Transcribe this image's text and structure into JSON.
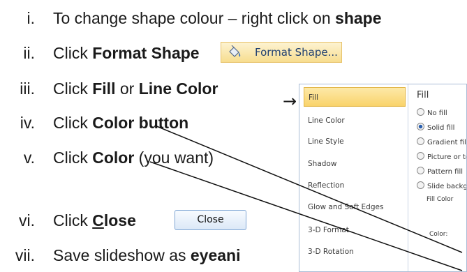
{
  "steps": [
    {
      "num": "i.",
      "pre": "To change shape colour – right click on ",
      "bold": "shape",
      "post": ""
    },
    {
      "num": "ii.",
      "pre": "Click ",
      "bold": "Format Shape",
      "post": ""
    },
    {
      "num": "iii.",
      "pre": "Click ",
      "bold": "Fill",
      "mid": " or ",
      "bold2": "Line Color",
      "post": ""
    },
    {
      "num": "iv.",
      "pre": "Click ",
      "bold": "Color button",
      "post": ""
    },
    {
      "num": "v.",
      "pre": "Click ",
      "bold": "Color",
      "post": " (you want)"
    },
    {
      "num": "vi.",
      "pre": "Click ",
      "bold_u": "C",
      "bold": "lose",
      "post": ""
    },
    {
      "num": "vii.",
      "pre": "Save slideshow as ",
      "bold": "eyeani",
      "post": ""
    }
  ],
  "format_shape_item": {
    "label": "Format Shape...",
    "icon": "paint-bucket-icon"
  },
  "arrow_symbol": "→",
  "close_button_label": "Close",
  "dialog": {
    "nav_items": [
      "Fill",
      "Line Color",
      "Line Style",
      "Shadow",
      "Reflection",
      "Glow and Soft Edges",
      "3-D Format",
      "3-D Rotation"
    ],
    "panel_title": "Fill",
    "options": [
      "No fill",
      "Solid fill",
      "Gradient fill",
      "Picture or texture fill",
      "Pattern fill",
      "Slide background fill"
    ],
    "selected_option": "Solid fill",
    "fill_color_label": "Fill Color",
    "color_label": "Color:"
  },
  "colors": {
    "highlight": "#f9d36b",
    "button_border": "#7fa6d4",
    "text": "#1a1a1a"
  }
}
